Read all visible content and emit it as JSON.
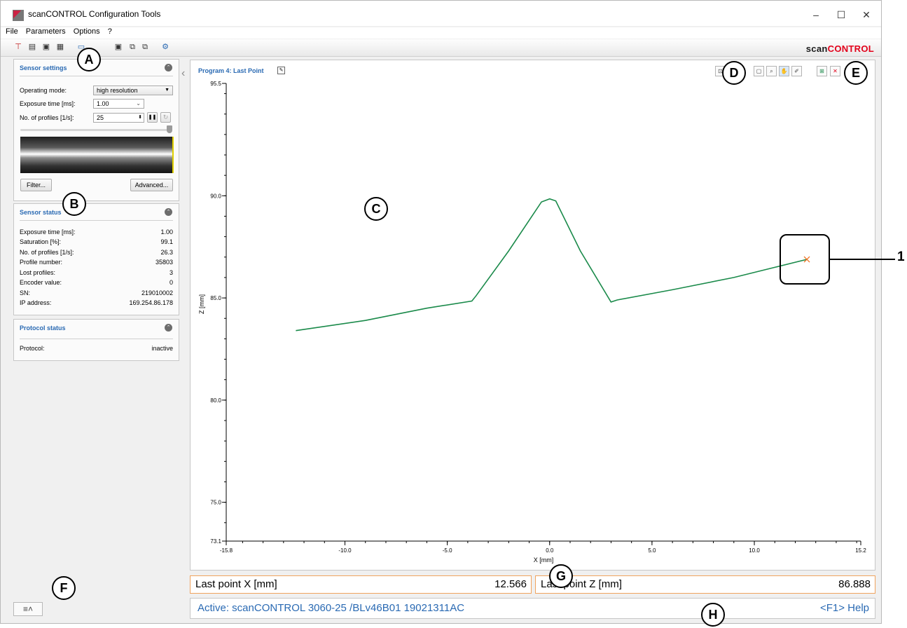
{
  "window": {
    "title": "scanCONTROL Configuration Tools",
    "minimize": "–",
    "maximize": "☐",
    "close": "✕"
  },
  "menu": [
    "File",
    "Parameters",
    "Options",
    "?"
  ],
  "brand": {
    "part1": "scan",
    "part2": "CONTROL",
    "accent": "#e2001a"
  },
  "sensor_settings": {
    "title": "Sensor settings",
    "operating_mode_label": "Operating mode:",
    "operating_mode_value": "high resolution",
    "exposure_label": "Exposure time [ms]:",
    "exposure_value": "1.00",
    "profiles_label": "No. of profiles [1/s]:",
    "profiles_value": "25",
    "filter_button": "Filter...",
    "advanced_button": "Advanced..."
  },
  "sensor_status": {
    "title": "Sensor status",
    "rows": [
      {
        "label": "Exposure time [ms]:",
        "value": "1.00"
      },
      {
        "label": "Saturation [%]:",
        "value": "99.1"
      },
      {
        "label": "No. of profiles [1/s]:",
        "value": "26.3"
      },
      {
        "label": "Profile number:",
        "value": "35803"
      },
      {
        "label": "Lost profiles:",
        "value": "3"
      },
      {
        "label": "Encoder value:",
        "value": "0"
      },
      {
        "label": "SN:",
        "value": "219010002"
      },
      {
        "label": "IP address:",
        "value": "169.254.86.178"
      }
    ]
  },
  "protocol_status": {
    "title": "Protocol status",
    "rows": [
      {
        "label": "Protocol:",
        "value": "inactive"
      }
    ]
  },
  "plot": {
    "title": "Program 4: Last Point",
    "xlabel": "X [mm]",
    "ylabel": "Z [mm]",
    "y_ticks": [
      "95.5",
      "90.0",
      "85.0",
      "80.0",
      "75.0",
      "73.1"
    ],
    "x_ticks": [
      "-15.8",
      "-10.0",
      "-5.0",
      "0.0",
      "5.0",
      "10.0",
      "15.2"
    ],
    "line_color": "#1a8a4a",
    "marker_color": "#f07020"
  },
  "chart_data": {
    "type": "line",
    "xlabel": "X [mm]",
    "ylabel": "Z [mm]",
    "xlim": [
      -15.8,
      15.2
    ],
    "ylim": [
      73.1,
      95.5
    ],
    "series": [
      {
        "x": [
          -12.4,
          -9.0,
          -6.0,
          -3.8,
          -3.6,
          -2.0,
          -0.4,
          0.0,
          0.3,
          1.5,
          3.0,
          3.3,
          6.0,
          9.0,
          11.0,
          12.566
        ],
        "y": [
          83.4,
          83.9,
          84.5,
          84.85,
          85.1,
          87.3,
          89.7,
          89.85,
          89.75,
          87.3,
          84.8,
          84.9,
          85.4,
          86.0,
          86.5,
          86.888
        ]
      }
    ],
    "marker": {
      "x": 12.566,
      "y": 86.888
    }
  },
  "results": {
    "last_x_label": "Last point X [mm]",
    "last_x_value": "12.566",
    "last_z_label": "Last point Z [mm]",
    "last_z_value": "86.888"
  },
  "status": {
    "active": "Active: scanCONTROL 3060-25 /BLv46B01  19021311AC",
    "help": "<F1> Help"
  },
  "callouts": {
    "A": "A",
    "B": "B",
    "C": "C",
    "D": "D",
    "E": "E",
    "F": "F",
    "G": "G",
    "H": "H",
    "one": "1"
  }
}
